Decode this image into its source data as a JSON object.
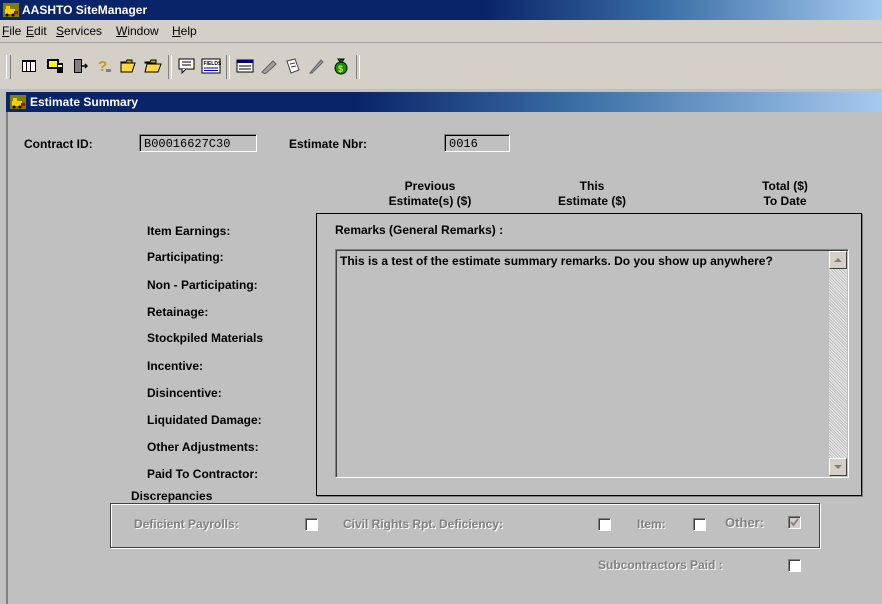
{
  "app": {
    "title": "AASHTO SiteManager"
  },
  "menu": [
    {
      "label": "File",
      "ul": "F",
      "rest": "ile"
    },
    {
      "label": "Edit",
      "ul": "E",
      "rest": "dit"
    },
    {
      "label": "Services",
      "ul": "S",
      "rest": "ervices"
    },
    {
      "label": "Window",
      "ul": "W",
      "rest": "indow"
    },
    {
      "label": "Help",
      "ul": "H",
      "rest": "elp"
    }
  ],
  "toolbar_icons": [
    "calculator-icon",
    "monitor-icon",
    "exit-door-icon",
    "help-question-icon",
    "open-folder-icon",
    "open-folder-2-icon",
    "speech-bubble-icon",
    "fields-icon",
    "table-window-icon",
    "tools-icon",
    "document-icon",
    "pen-icon",
    "money-bag-icon"
  ],
  "window": {
    "title": "Estimate Summary"
  },
  "header": {
    "contract_label": "Contract ID:",
    "contract_value": "B00016627C30",
    "estimate_label": "Estimate Nbr:",
    "estimate_value": "0016"
  },
  "columns": {
    "previous_1": "Previous",
    "previous_2": "Estimate(s) ($)",
    "this_1": "This",
    "this_2": "Estimate ($)",
    "total_1": "Total ($)",
    "total_2": "To Date"
  },
  "rows": [
    "Item Earnings:",
    "Participating:",
    "Non - Participating:",
    "Retainage:",
    "Stockpiled Materials",
    "Incentive:",
    "Disincentive:",
    "Liquidated Damage:",
    "Other Adjustments:",
    "Paid To Contractor:"
  ],
  "remarks": {
    "title": "Remarks (General Remarks) :",
    "text": "This is a test of the estimate summary remarks.  Do you show up anywhere?"
  },
  "discrepancies": {
    "title": "Discrepancies",
    "deficient_payrolls": "Deficient Payrolls:",
    "civil_rights": "Civil Rights Rpt. Deficiency:",
    "item": "Item:",
    "other": "Other:",
    "other_checked": true
  },
  "subcontractors_paid": "Subcontractors Paid :",
  "colors": {
    "title_bar": "#0a246a",
    "face": "#c0c0c0"
  }
}
